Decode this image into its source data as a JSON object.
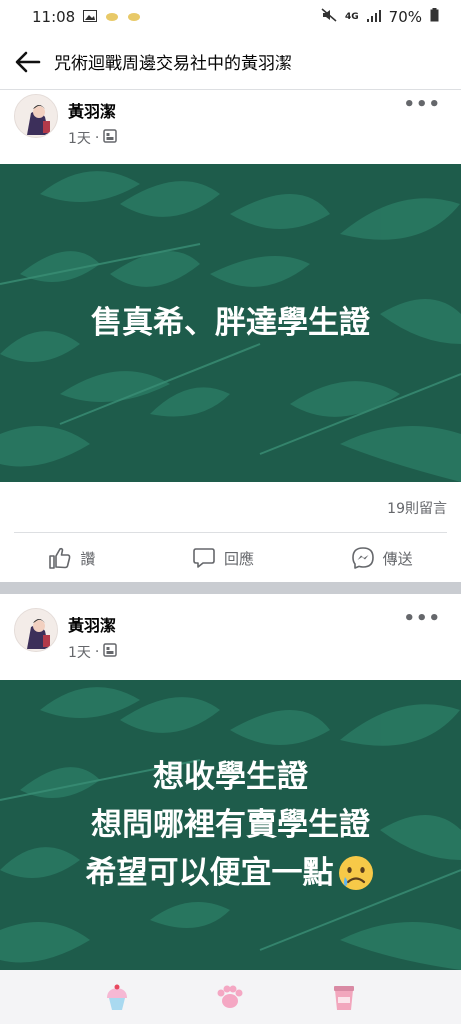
{
  "status_bar": {
    "time": "11:08",
    "battery": "70%",
    "network": "4G"
  },
  "header": {
    "title": "咒術迴戰周邊交易社中的黃羽潔"
  },
  "posts": [
    {
      "author": "黃羽潔",
      "time": "1天",
      "dot": "·",
      "text_lines": [
        "售真希、胖達學生證"
      ],
      "comments": "19則留言",
      "actions": {
        "like": "讚",
        "comment": "回應",
        "share": "傳送"
      }
    },
    {
      "author": "黃羽潔",
      "time": "1天",
      "dot": "·",
      "text_lines": [
        "想收學生證",
        "想問哪裡有賣學生證",
        "希望可以便宜一點"
      ]
    }
  ],
  "colors": {
    "banner_bg": "#1e5c4b",
    "leaf": "#2a7a63",
    "muted": "#65676b"
  },
  "bottom_nav": {
    "icons": [
      "cupcake-icon",
      "paw-icon",
      "cup-icon"
    ]
  }
}
